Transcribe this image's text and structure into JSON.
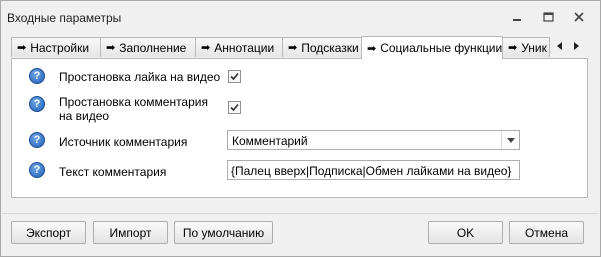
{
  "window": {
    "title": "Входные параметры"
  },
  "tabs": [
    {
      "label": "Настройки",
      "arrow": "➡"
    },
    {
      "label": "Заполнение",
      "arrow": "➡"
    },
    {
      "label": "Аннотации",
      "arrow": "➡"
    },
    {
      "label": "Подсказки",
      "arrow": "➡"
    },
    {
      "label": "Социальные функции",
      "arrow": "➡",
      "active": true
    },
    {
      "label": "Уник",
      "arrow": "➡"
    }
  ],
  "settings": {
    "like": {
      "label": "Простановка лайка на видео",
      "checked": true
    },
    "comment": {
      "label": "Простановка комментария на видео",
      "checked": true
    },
    "comment_source": {
      "label": "Источник комментария",
      "value": "Комментарий"
    },
    "comment_text": {
      "label": "Текст комментария",
      "value": "{Палец вверх|Подписка|Обмен лайками на видео}"
    }
  },
  "help_glyph": "?",
  "buttons": {
    "export": "Экспорт",
    "import": "Импорт",
    "default": "По умолчанию",
    "ok": "OK",
    "cancel": "Отмена"
  },
  "icons": [
    "minimize-icon",
    "maximize-icon",
    "close-icon",
    "tab-arrow-icon",
    "scroll-left-icon",
    "scroll-right-icon",
    "help-icon",
    "checkmark-icon",
    "chevron-down-icon"
  ],
  "colors": {
    "help_icon": "#2f6fc9",
    "panel_bg": "#ffffff",
    "window_bg": "#f0f0f0"
  }
}
